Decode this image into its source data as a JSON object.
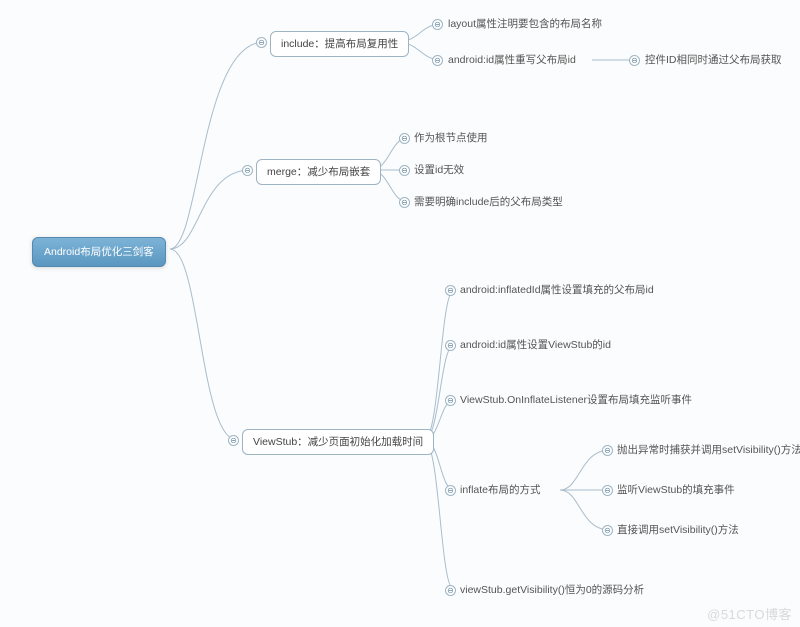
{
  "root": "Android布局优化三剑客",
  "include": {
    "title": "include：提高布局复用性",
    "c1": "layout属性注明要包含的布局名称",
    "c2": "android:id属性重写父布局id",
    "c2a": "控件ID相同时通过父布局获取"
  },
  "merge": {
    "title": "merge：减少布局嵌套",
    "c1": "作为根节点使用",
    "c2": "设置id无效",
    "c3": "需要明确include后的父布局类型"
  },
  "viewstub": {
    "title": "ViewStub：减少页面初始化加载时间",
    "c1": "android:inflatedId属性设置填充的父布局id",
    "c2": "android:id属性设置ViewStub的id",
    "c3": "ViewStub.OnInflateListener设置布局填充监听事件",
    "c4": "inflate布局的方式",
    "c4a": "抛出异常时捕获并调用setVisibility()方法",
    "c4b": "监听ViewStub的填充事件",
    "c4c": "直接调用setVisibility()方法",
    "c5": "viewStub.getVisibility()恒为0的源码分析"
  },
  "collapseGlyph": "⊖",
  "watermark": "@51CTO博客"
}
